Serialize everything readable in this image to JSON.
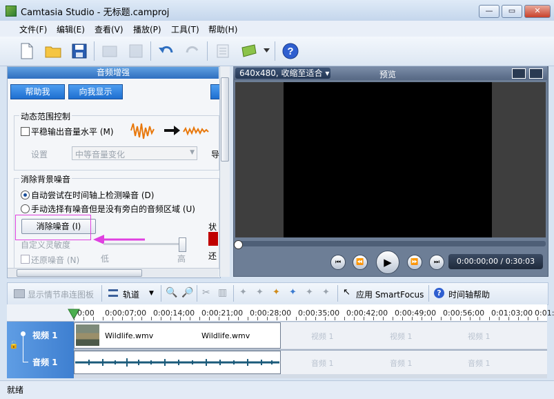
{
  "window": {
    "title": "Camtasia Studio - 无标题.camproj",
    "close_label": "✕",
    "max_label": "▭",
    "min_label": "—"
  },
  "menu": [
    "文件(F)",
    "编辑(E)",
    "查看(V)",
    "播放(P)",
    "工具(T)",
    "帮助(H)"
  ],
  "audio_panel": {
    "header": "音频增强",
    "help_btn": "帮助我",
    "show_btn": "向我显示",
    "dynamic_group": "动态范围控制",
    "even_volume": "平稳输出音量水平 (M)",
    "setting_label": "设置",
    "setting_value": "中等音量变化",
    "setting_trail": "导",
    "noise_group": "消除背景噪音",
    "radio_auto": "自动尝试在时间轴上检测噪音 (D)",
    "radio_manual": "手动选择有噪音但是没有旁白的音频区域 (U)",
    "remove_btn": "消除噪音 (I)",
    "sensitivity": "自定义灵敏度",
    "restore": "还原噪音 (N)",
    "low": "低",
    "high": "高",
    "status_label": "状",
    "trail2": "还"
  },
  "preview": {
    "size_label": "640x480, 收缩至适合 ▾",
    "title": "预览",
    "time": "0:00:00;00 / 0:30:03"
  },
  "timeline_toolbar": {
    "storyboard": "显示情节串连图板",
    "tracks": "轨道",
    "smartfocus": "应用 SmartFocus",
    "help": "时间轴帮助"
  },
  "ruler": [
    "0:00",
    "0:00:07;00",
    "0:00:14;00",
    "0:00:21;00",
    "0:00:28;00",
    "0:00:35;00",
    "0:00:42;00",
    "0:00:49;00",
    "0:00:56;00",
    "0:01:03;00",
    "0:01:"
  ],
  "tracks": {
    "video_label": "视频 1",
    "audio_label": "音频 1",
    "clip1": "Wildlife.wmv",
    "clip2": "Wildlife.wmv",
    "ghost_video": "视频 1",
    "ghost_audio": "音频 1"
  },
  "status": "就绪",
  "colors": {
    "accent": "#2f6fc0",
    "highlight": "#e040e0"
  }
}
